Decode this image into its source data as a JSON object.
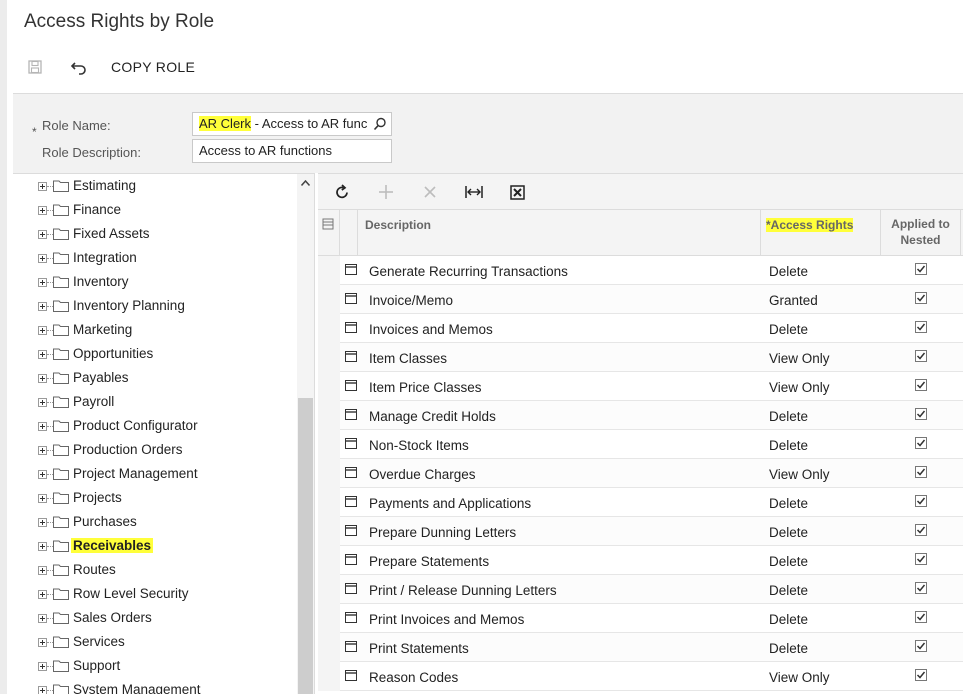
{
  "page": {
    "title": "Access Rights by Role"
  },
  "toolbar": {
    "save_icon": "save-icon",
    "undo_icon": "undo-icon",
    "copy_role_label": "COPY ROLE"
  },
  "form": {
    "required_marker": "*",
    "role_name_label": "Role Name:",
    "role_name_highlight": "AR Clerk",
    "role_name_rest": " - Access to AR func",
    "role_description_label": "Role Description:",
    "role_description_value": "Access to AR functions"
  },
  "tree": {
    "items": [
      {
        "label": "Estimating"
      },
      {
        "label": "Finance"
      },
      {
        "label": "Fixed Assets"
      },
      {
        "label": "Integration"
      },
      {
        "label": "Inventory"
      },
      {
        "label": "Inventory Planning"
      },
      {
        "label": "Marketing"
      },
      {
        "label": "Opportunities"
      },
      {
        "label": "Payables"
      },
      {
        "label": "Payroll"
      },
      {
        "label": "Product Configurator"
      },
      {
        "label": "Production Orders"
      },
      {
        "label": "Project Management"
      },
      {
        "label": "Projects"
      },
      {
        "label": "Purchases"
      },
      {
        "label": "Receivables",
        "selected": true
      },
      {
        "label": "Routes"
      },
      {
        "label": "Row Level Security"
      },
      {
        "label": "Sales Orders"
      },
      {
        "label": "Services"
      },
      {
        "label": "Support"
      },
      {
        "label": "System Management"
      }
    ]
  },
  "grid": {
    "toolbar_icons": [
      "refresh-icon",
      "add-icon",
      "delete-icon",
      "fit-columns-icon",
      "export-excel-icon"
    ],
    "columns": {
      "description": "Description",
      "access_rights": "*Access Rights",
      "applied_to_nested_line1": "Applied to",
      "applied_to_nested_line2": "Nested"
    },
    "rows": [
      {
        "description": "Generate Recurring Transactions",
        "access": "Delete",
        "nested": true
      },
      {
        "description": "Invoice/Memo",
        "access": "Granted",
        "nested": true
      },
      {
        "description": "Invoices and Memos",
        "access": "Delete",
        "nested": true
      },
      {
        "description": "Item Classes",
        "access": "View Only",
        "nested": true
      },
      {
        "description": "Item Price Classes",
        "access": "View Only",
        "nested": true
      },
      {
        "description": "Manage Credit Holds",
        "access": "Delete",
        "nested": true
      },
      {
        "description": "Non-Stock Items",
        "access": "Delete",
        "nested": true
      },
      {
        "description": "Overdue Charges",
        "access": "View Only",
        "nested": true
      },
      {
        "description": "Payments and Applications",
        "access": "Delete",
        "nested": true
      },
      {
        "description": "Prepare Dunning Letters",
        "access": "Delete",
        "nested": true
      },
      {
        "description": "Prepare Statements",
        "access": "Delete",
        "nested": true
      },
      {
        "description": "Print / Release Dunning Letters",
        "access": "Delete",
        "nested": true
      },
      {
        "description": "Print Invoices and Memos",
        "access": "Delete",
        "nested": true
      },
      {
        "description": "Print Statements",
        "access": "Delete",
        "nested": true
      },
      {
        "description": "Reason Codes",
        "access": "View Only",
        "nested": true
      }
    ]
  },
  "colors": {
    "highlight": "#ffff3a",
    "panel": "#f2f2f2",
    "border": "#dcdcdc"
  }
}
